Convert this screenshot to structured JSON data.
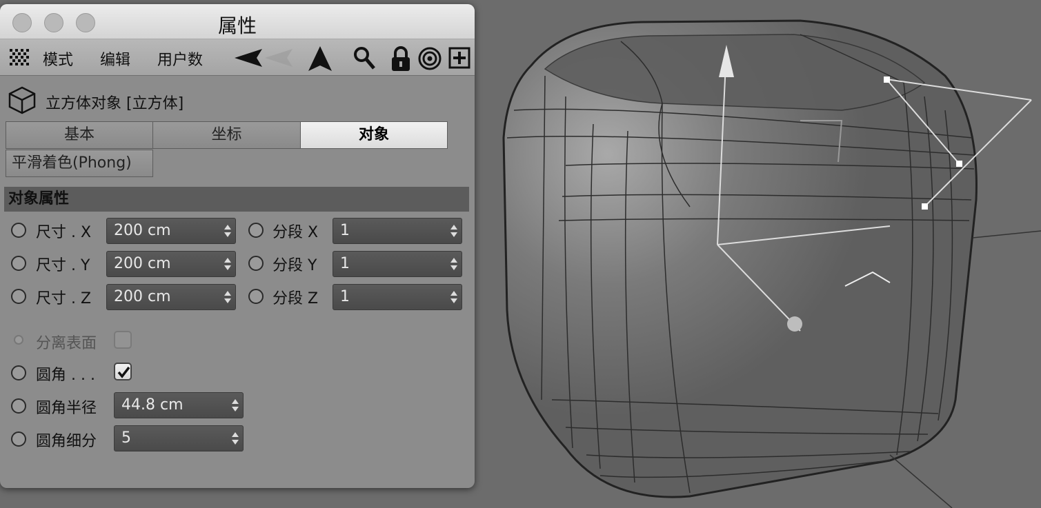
{
  "window": {
    "title": "属性"
  },
  "menu": {
    "items": [
      "模式",
      "编辑",
      "用户数"
    ]
  },
  "object": {
    "title": "立方体对象 [立方体]"
  },
  "tabs": [
    {
      "label": "基本",
      "active": false
    },
    {
      "label": "坐标",
      "active": false
    },
    {
      "label": "对象",
      "active": true
    },
    {
      "label": "平滑着色(Phong)",
      "active": false
    }
  ],
  "section": {
    "title": "对象属性"
  },
  "size_fields": [
    {
      "label": "尺寸 . X",
      "value": "200 cm"
    },
    {
      "label": "尺寸 . Y",
      "value": "200 cm"
    },
    {
      "label": "尺寸 . Z",
      "value": "200 cm"
    }
  ],
  "segment_fields": [
    {
      "label": "分段 X",
      "value": "1"
    },
    {
      "label": "分段 Y",
      "value": "1"
    },
    {
      "label": "分段 Z",
      "value": "1"
    }
  ],
  "separate_surfaces": {
    "label": "分离表面",
    "checked": false,
    "enabled": false
  },
  "fillet": {
    "label": "圆角 . . .",
    "checked": true
  },
  "fillet_radius": {
    "label": "圆角半径",
    "value": "44.8 cm"
  },
  "fillet_subdivision": {
    "label": "圆角细分",
    "value": "5"
  }
}
